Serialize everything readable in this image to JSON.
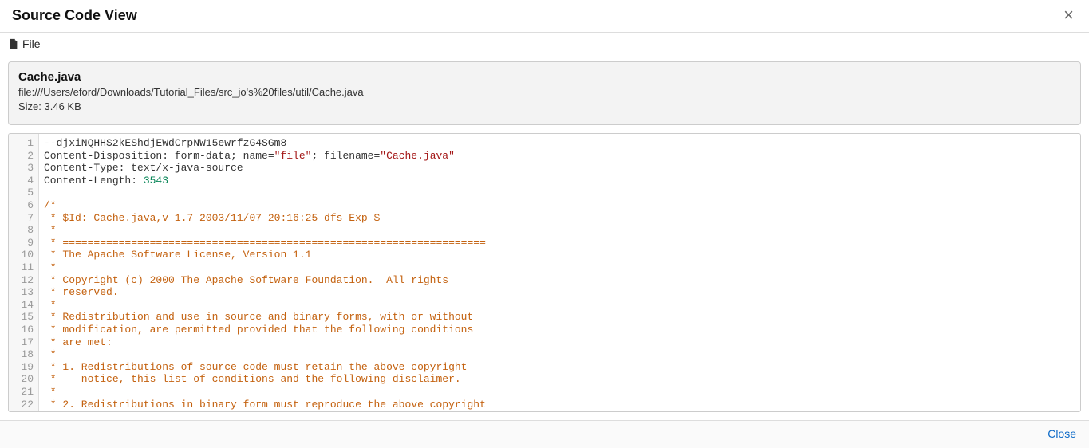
{
  "header": {
    "title": "Source Code View",
    "close_label": "×"
  },
  "menu": {
    "file_label": "File"
  },
  "file_info": {
    "name": "Cache.java",
    "path": "file:///Users/eford/Downloads/Tutorial_Files/src_jo's%20files/util/Cache.java",
    "size_label": "Size: 3.46 KB"
  },
  "code": {
    "lines": [
      {
        "n": 1,
        "segs": [
          {
            "t": "--djxiNQHHS2kEShdjEWdCrpNW15ewrfzG4SGm8",
            "c": "plain"
          }
        ]
      },
      {
        "n": 2,
        "segs": [
          {
            "t": "Content-Disposition: form-data; name=",
            "c": "plain"
          },
          {
            "t": "\"file\"",
            "c": "str"
          },
          {
            "t": "; filename=",
            "c": "plain"
          },
          {
            "t": "\"Cache.java\"",
            "c": "str"
          }
        ]
      },
      {
        "n": 3,
        "segs": [
          {
            "t": "Content-Type: text/x-java-source",
            "c": "plain"
          }
        ]
      },
      {
        "n": 4,
        "segs": [
          {
            "t": "Content-Length: ",
            "c": "plain"
          },
          {
            "t": "3543",
            "c": "num"
          }
        ]
      },
      {
        "n": 5,
        "segs": [
          {
            "t": "",
            "c": "plain"
          }
        ]
      },
      {
        "n": 6,
        "segs": [
          {
            "t": "/*",
            "c": "comment"
          }
        ]
      },
      {
        "n": 7,
        "segs": [
          {
            "t": " * $Id: Cache.java,v 1.7 2003/11/07 20:16:25 dfs Exp $",
            "c": "comment"
          }
        ]
      },
      {
        "n": 8,
        "segs": [
          {
            "t": " *",
            "c": "comment"
          }
        ]
      },
      {
        "n": 9,
        "segs": [
          {
            "t": " * ====================================================================",
            "c": "comment"
          }
        ]
      },
      {
        "n": 10,
        "segs": [
          {
            "t": " * The Apache Software License, Version 1.1",
            "c": "comment"
          }
        ]
      },
      {
        "n": 11,
        "segs": [
          {
            "t": " *",
            "c": "comment"
          }
        ]
      },
      {
        "n": 12,
        "segs": [
          {
            "t": " * Copyright (c) 2000 The Apache Software Foundation.  All rights",
            "c": "comment"
          }
        ]
      },
      {
        "n": 13,
        "segs": [
          {
            "t": " * reserved.",
            "c": "comment"
          }
        ]
      },
      {
        "n": 14,
        "segs": [
          {
            "t": " *",
            "c": "comment"
          }
        ]
      },
      {
        "n": 15,
        "segs": [
          {
            "t": " * Redistribution and use in source and binary forms, with or without",
            "c": "comment"
          }
        ]
      },
      {
        "n": 16,
        "segs": [
          {
            "t": " * modification, are permitted provided that the following conditions",
            "c": "comment"
          }
        ]
      },
      {
        "n": 17,
        "segs": [
          {
            "t": " * are met:",
            "c": "comment"
          }
        ]
      },
      {
        "n": 18,
        "segs": [
          {
            "t": " *",
            "c": "comment"
          }
        ]
      },
      {
        "n": 19,
        "segs": [
          {
            "t": " * 1. Redistributions of source code must retain the above copyright",
            "c": "comment"
          }
        ]
      },
      {
        "n": 20,
        "segs": [
          {
            "t": " *    notice, this list of conditions and the following disclaimer.",
            "c": "comment"
          }
        ]
      },
      {
        "n": 21,
        "segs": [
          {
            "t": " *",
            "c": "comment"
          }
        ]
      },
      {
        "n": 22,
        "segs": [
          {
            "t": " * 2. Redistributions in binary form must reproduce the above copyright",
            "c": "comment"
          }
        ]
      }
    ]
  },
  "footer": {
    "close_label": "Close"
  }
}
